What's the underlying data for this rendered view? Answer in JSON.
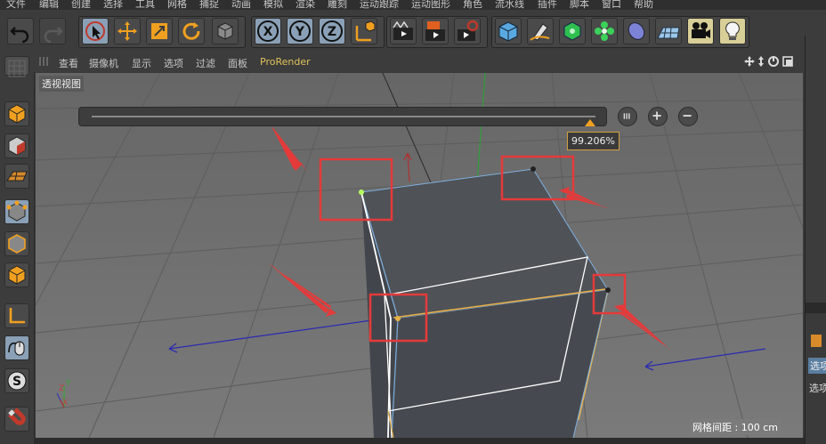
{
  "menubar": {
    "items": [
      "文件",
      "编辑",
      "创建",
      "选择",
      "工具",
      "网格",
      "捕捉",
      "动画",
      "模拟",
      "渲染",
      "雕刻",
      "运动跟踪",
      "运动图形",
      "角色",
      "流水线",
      "插件",
      "脚本",
      "窗口",
      "帮助"
    ]
  },
  "toolbar": {
    "axis_x": "X",
    "axis_y": "Y",
    "axis_z": "Z",
    "icons": [
      "undo-icon",
      "redo-icon",
      "live-select-icon",
      "move-icon",
      "scale-icon",
      "rotate-icon",
      "recent-tool-icon",
      "x-axis-lock-icon",
      "y-axis-lock-icon",
      "z-axis-lock-icon",
      "coordinate-system-icon",
      "render-view-icon",
      "render-to-picture-viewer-icon",
      "render-settings-icon",
      "cube-icon",
      "pen-icon",
      "subdivision-icon",
      "cloner-icon",
      "deformer-icon",
      "floor-icon",
      "camera-icon",
      "light-icon"
    ]
  },
  "viewport_menu": {
    "items": [
      "查看",
      "摄像机",
      "显示",
      "选项",
      "过滤",
      "面板"
    ],
    "prorender": "ProRender",
    "nav_icons": [
      "move-view-icon",
      "zoom-view-icon",
      "rotate-view-icon",
      "toggle-view-icon"
    ]
  },
  "viewport": {
    "label": "透视视图",
    "slider_percent": "99.206%",
    "slider_value": 0.99206,
    "grid_spacing": "网格间距 : 100 cm",
    "axis_y": "Y",
    "axis_z": "Z",
    "axis_x": "X"
  },
  "leftbar": {
    "icons": [
      "make-editable-icon",
      "texture-mode-icon",
      "workplane-icon",
      "points-mode-icon",
      "edges-mode-icon",
      "polygons-mode-icon",
      "axis-mode-icon",
      "tweak-mode-icon",
      "snap-icon",
      "magnet-icon"
    ]
  },
  "rightpanel": {
    "tab_label": "选项",
    "tab_label_2": "选项"
  },
  "colors": {
    "viewport_bg": "#6b6b6b",
    "cube_face": "#4f5257",
    "selection": "#ffffff",
    "annotation": "#e53a3a",
    "highlight_edge": "#e8b04a"
  }
}
